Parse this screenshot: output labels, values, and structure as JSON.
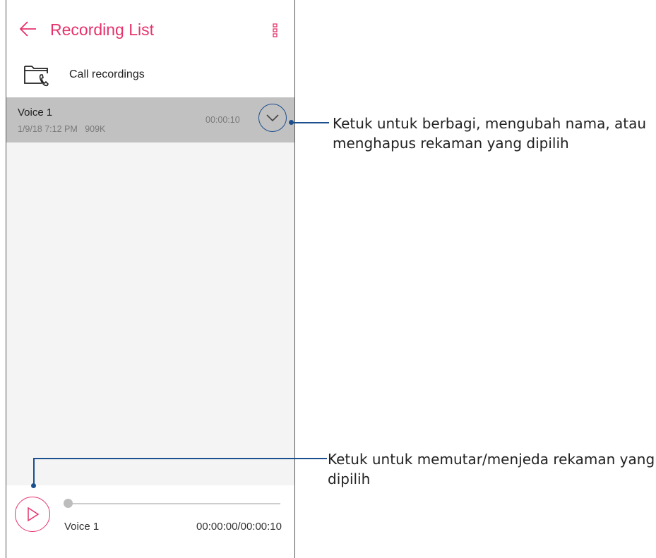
{
  "header": {
    "title": "Recording List",
    "back_icon": "arrow-left-icon",
    "menu_icon": "more-vertical-icon",
    "accent_color": "#e6336c"
  },
  "folder": {
    "label": "Call recordings",
    "icon": "phone-folder-icon"
  },
  "recordings": [
    {
      "name": "Voice 1",
      "meta": "1/9/18 7:12 PM   909K",
      "duration": "00:00:10",
      "selected": true
    }
  ],
  "player": {
    "track_name": "Voice 1",
    "time": "00:00:00/00:00:10",
    "progress_fraction": 0
  },
  "annotations": [
    {
      "text_line1": "Ketuk untuk berbagi, mengubah nama, atau",
      "text_line2": "menghapus rekaman yang dipilih"
    },
    {
      "text_line1": "Ketuk untuk memutar/menjeda rekaman yang",
      "text_line2": "dipilih"
    }
  ]
}
